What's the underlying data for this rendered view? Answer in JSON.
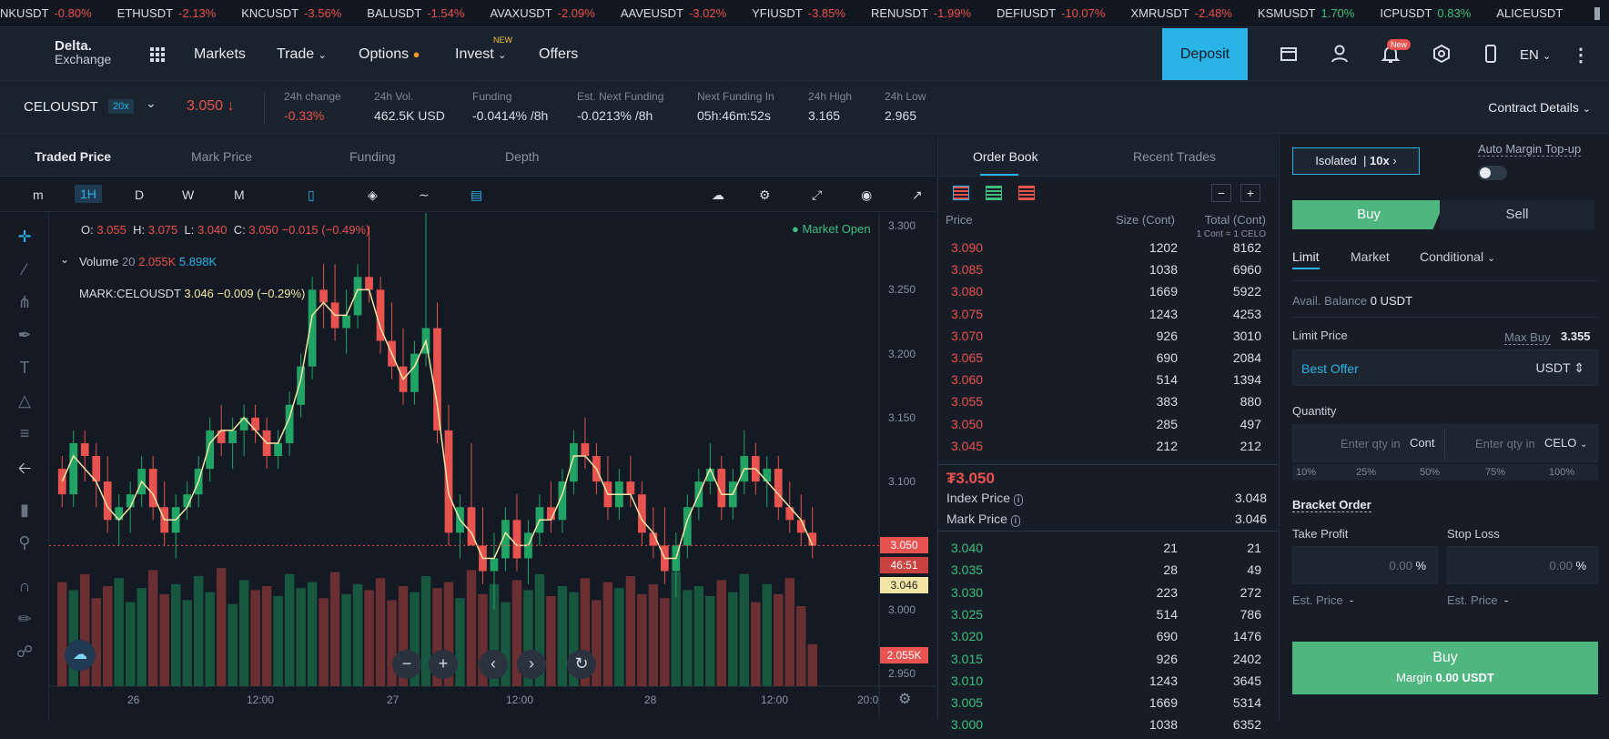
{
  "ticker": [
    {
      "s": "NKUSDT",
      "c": "-0.80%",
      "up": false
    },
    {
      "s": "ETHUSDT",
      "c": "-2.13%",
      "up": false
    },
    {
      "s": "KNCUSDT",
      "c": "-3.56%",
      "up": false
    },
    {
      "s": "BALUSDT",
      "c": "-1.54%",
      "up": false
    },
    {
      "s": "AVAXUSDT",
      "c": "-2.09%",
      "up": false
    },
    {
      "s": "AAVEUSDT",
      "c": "-3.02%",
      "up": false
    },
    {
      "s": "YFIUSDT",
      "c": "-3.85%",
      "up": false
    },
    {
      "s": "RENUSDT",
      "c": "-1.99%",
      "up": false
    },
    {
      "s": "DEFIUSDT",
      "c": "-10.07%",
      "up": false
    },
    {
      "s": "XMRUSDT",
      "c": "-2.48%",
      "up": false
    },
    {
      "s": "KSMUSDT",
      "c": "1.70%",
      "up": true
    },
    {
      "s": "ICPUSDT",
      "c": "0.83%",
      "up": true
    },
    {
      "s": "ALICEUSDT",
      "c": "",
      "up": false
    }
  ],
  "brand": {
    "line1": "Delta.",
    "line2": "Exchange"
  },
  "nav": {
    "markets": "Markets",
    "trade": "Trade",
    "options": "Options",
    "invest": "Invest",
    "invest_tag": "NEW",
    "offers": "Offers",
    "deposit": "Deposit",
    "new_badge": "New",
    "lang": "EN"
  },
  "stats": {
    "symbol": "CELOUSDT",
    "leverage": "20x",
    "last": "3.050",
    "items": [
      {
        "l": "24h change",
        "v": "-0.33%",
        "neg": true
      },
      {
        "l": "24h Vol.",
        "v": "462.5K USD"
      },
      {
        "l": "Funding",
        "v": "-0.0414% /8h"
      },
      {
        "l": "Est. Next Funding",
        "v": "-0.0213% /8h"
      },
      {
        "l": "Next Funding In",
        "v": "05h:46m:52s"
      },
      {
        "l": "24h High",
        "v": "3.165"
      },
      {
        "l": "24h Low",
        "v": "2.965"
      }
    ],
    "contract": "Contract Details"
  },
  "chart_tabs": [
    "Traded Price",
    "Mark Price",
    "Funding",
    "Depth"
  ],
  "toolbar": {
    "m": "m",
    "h": "1H",
    "d": "D",
    "w": "W",
    "mo": "M"
  },
  "legend": {
    "o": "3.055",
    "h": "3.075",
    "l": "3.040",
    "c": "3.050",
    "chg": "−0.015 (−0.49%)",
    "vol_label": "Volume",
    "vol_len": "20",
    "vol1": "2.055K",
    "vol2": "5.898K",
    "mark_label": "MARK:CELOUSDT",
    "mark_val": "3.046",
    "mark_chg": "−0.009 (−0.29%)",
    "market_open": "● Market Open"
  },
  "chart_data": {
    "type": "candlestick",
    "x_labels": [
      "26",
      "12:00",
      "27",
      "12:00",
      "28",
      "12:00",
      "20:0"
    ],
    "y_ticks": [
      "3.300",
      "3.250",
      "3.200",
      "3.150",
      "3.100",
      "3.050",
      "3.000",
      "2.950"
    ],
    "ylim": [
      2.94,
      3.31
    ],
    "last_price": "3.050",
    "countdown": "46:51",
    "mark_price": "3.046",
    "volume_label": "2.055K",
    "candles": [
      [
        3.11,
        3.12,
        3.08,
        3.09
      ],
      [
        3.09,
        3.14,
        3.08,
        3.13
      ],
      [
        3.13,
        3.14,
        3.1,
        3.12
      ],
      [
        3.12,
        3.13,
        3.08,
        3.1
      ],
      [
        3.1,
        3.12,
        3.06,
        3.07
      ],
      [
        3.07,
        3.09,
        3.05,
        3.08
      ],
      [
        3.08,
        3.1,
        3.06,
        3.09
      ],
      [
        3.09,
        3.12,
        3.08,
        3.11
      ],
      [
        3.11,
        3.12,
        3.07,
        3.08
      ],
      [
        3.08,
        3.1,
        3.05,
        3.06
      ],
      [
        3.06,
        3.09,
        3.04,
        3.08
      ],
      [
        3.08,
        3.1,
        3.07,
        3.09
      ],
      [
        3.09,
        3.12,
        3.08,
        3.11
      ],
      [
        3.11,
        3.15,
        3.1,
        3.14
      ],
      [
        3.14,
        3.16,
        3.12,
        3.13
      ],
      [
        3.13,
        3.15,
        3.11,
        3.14
      ],
      [
        3.14,
        3.16,
        3.12,
        3.15
      ],
      [
        3.15,
        3.16,
        3.13,
        3.14
      ],
      [
        3.14,
        3.15,
        3.11,
        3.12
      ],
      [
        3.12,
        3.14,
        3.11,
        3.13
      ],
      [
        3.13,
        3.17,
        3.12,
        3.16
      ],
      [
        3.16,
        3.2,
        3.15,
        3.19
      ],
      [
        3.19,
        3.26,
        3.18,
        3.25
      ],
      [
        3.25,
        3.27,
        3.22,
        3.24
      ],
      [
        3.24,
        3.27,
        3.21,
        3.22
      ],
      [
        3.22,
        3.25,
        3.2,
        3.23
      ],
      [
        3.23,
        3.27,
        3.22,
        3.26
      ],
      [
        3.26,
        3.3,
        3.24,
        3.25
      ],
      [
        3.25,
        3.26,
        3.2,
        3.21
      ],
      [
        3.21,
        3.24,
        3.18,
        3.19
      ],
      [
        3.19,
        3.22,
        3.16,
        3.17
      ],
      [
        3.17,
        3.21,
        3.16,
        3.2
      ],
      [
        3.2,
        3.31,
        3.19,
        3.22
      ],
      [
        3.22,
        3.24,
        3.13,
        3.14
      ],
      [
        3.14,
        3.16,
        3.05,
        3.06
      ],
      [
        3.06,
        3.09,
        3.04,
        3.08
      ],
      [
        3.08,
        3.13,
        3.07,
        3.05
      ],
      [
        3.05,
        3.08,
        3.02,
        3.03
      ],
      [
        3.03,
        3.06,
        3.0,
        3.04
      ],
      [
        3.04,
        3.08,
        3.03,
        3.07
      ],
      [
        3.07,
        3.09,
        3.03,
        3.04
      ],
      [
        3.04,
        3.07,
        3.02,
        3.06
      ],
      [
        3.06,
        3.09,
        3.05,
        3.08
      ],
      [
        3.08,
        3.1,
        3.06,
        3.07
      ],
      [
        3.07,
        3.11,
        3.06,
        3.1
      ],
      [
        3.1,
        3.14,
        3.09,
        3.13
      ],
      [
        3.13,
        3.15,
        3.11,
        3.12
      ],
      [
        3.12,
        3.13,
        3.09,
        3.1
      ],
      [
        3.1,
        3.12,
        3.07,
        3.08
      ],
      [
        3.08,
        3.11,
        3.07,
        3.1
      ],
      [
        3.1,
        3.12,
        3.08,
        3.09
      ],
      [
        3.09,
        3.1,
        3.05,
        3.06
      ],
      [
        3.06,
        3.08,
        3.04,
        3.05
      ],
      [
        3.05,
        3.08,
        3.02,
        3.03
      ],
      [
        3.03,
        3.06,
        3.01,
        3.05
      ],
      [
        3.05,
        3.09,
        3.04,
        3.08
      ],
      [
        3.08,
        3.11,
        3.07,
        3.1
      ],
      [
        3.1,
        3.13,
        3.09,
        3.11
      ],
      [
        3.11,
        3.12,
        3.07,
        3.08
      ],
      [
        3.08,
        3.11,
        3.07,
        3.1
      ],
      [
        3.1,
        3.14,
        3.09,
        3.12
      ],
      [
        3.12,
        3.13,
        3.09,
        3.1
      ],
      [
        3.1,
        3.12,
        3.08,
        3.11
      ],
      [
        3.11,
        3.12,
        3.07,
        3.08
      ],
      [
        3.08,
        3.1,
        3.06,
        3.07
      ],
      [
        3.07,
        3.09,
        3.05,
        3.06
      ],
      [
        3.06,
        3.08,
        3.04,
        3.05
      ]
    ],
    "volumes": [
      5.2,
      4.8,
      5.6,
      4.4,
      5.0,
      5.4,
      4.2,
      4.9,
      5.8,
      4.6,
      5.1,
      4.3,
      5.5,
      4.7,
      5.9,
      4.1,
      5.3,
      4.8,
      5.0,
      4.5,
      5.6,
      4.9,
      5.2,
      4.4,
      5.7,
      4.6,
      5.1,
      4.8,
      5.4,
      4.3,
      5.0,
      4.7,
      5.5,
      4.9,
      5.2,
      4.4,
      5.8,
      4.6,
      5.1,
      4.2,
      5.3,
      4.8,
      5.6,
      4.5,
      5.0,
      4.7,
      5.4,
      4.3,
      5.2,
      4.9,
      5.5,
      4.6,
      5.1,
      4.4,
      5.7,
      4.8,
      5.0,
      4.5,
      5.3,
      4.7,
      5.6,
      4.2,
      5.1,
      4.6,
      5.4,
      4.0,
      2.1
    ],
    "mark_line": [
      3.1,
      3.12,
      3.11,
      3.1,
      3.08,
      3.07,
      3.08,
      3.1,
      3.09,
      3.07,
      3.07,
      3.08,
      3.1,
      3.13,
      3.14,
      3.14,
      3.15,
      3.14,
      3.13,
      3.13,
      3.15,
      3.18,
      3.23,
      3.24,
      3.23,
      3.23,
      3.25,
      3.25,
      3.22,
      3.2,
      3.18,
      3.19,
      3.21,
      3.16,
      3.09,
      3.07,
      3.06,
      3.04,
      3.04,
      3.06,
      3.05,
      3.05,
      3.07,
      3.07,
      3.09,
      3.12,
      3.12,
      3.11,
      3.09,
      3.09,
      3.09,
      3.07,
      3.06,
      3.04,
      3.04,
      3.07,
      3.09,
      3.11,
      3.09,
      3.09,
      3.11,
      3.11,
      3.1,
      3.09,
      3.08,
      3.07,
      3.05
    ]
  },
  "orderbook": {
    "tabs": [
      "Order Book",
      "Recent Trades"
    ],
    "h_price": "Price",
    "h_size": "Size (Cont)",
    "h_total": "Total (Cont)",
    "contract_note": "1 Cont = 1 CELO",
    "asks": [
      [
        "3.090",
        "1202",
        "8162"
      ],
      [
        "3.085",
        "1038",
        "6960"
      ],
      [
        "3.080",
        "1669",
        "5922"
      ],
      [
        "3.075",
        "1243",
        "4253"
      ],
      [
        "3.070",
        "926",
        "3010"
      ],
      [
        "3.065",
        "690",
        "2084"
      ],
      [
        "3.060",
        "514",
        "1394"
      ],
      [
        "3.055",
        "383",
        "880"
      ],
      [
        "3.050",
        "285",
        "497"
      ],
      [
        "3.045",
        "212",
        "212"
      ]
    ],
    "mid": "₮3.050",
    "index_label": "Index Price",
    "index_val": "3.048",
    "mark_label": "Mark Price",
    "mark_val": "3.046",
    "bids": [
      [
        "3.040",
        "21",
        "21"
      ],
      [
        "3.035",
        "28",
        "49"
      ],
      [
        "3.030",
        "223",
        "272"
      ],
      [
        "3.025",
        "514",
        "786"
      ],
      [
        "3.020",
        "690",
        "1476"
      ],
      [
        "3.015",
        "926",
        "2402"
      ],
      [
        "3.010",
        "1243",
        "3645"
      ],
      [
        "3.005",
        "1669",
        "5314"
      ],
      [
        "3.000",
        "1038",
        "6352"
      ]
    ]
  },
  "order": {
    "isolated": "Isolated",
    "lev": "10x",
    "auto_margin": "Auto Margin Top-up",
    "buy": "Buy",
    "sell": "Sell",
    "types": [
      "Limit",
      "Market",
      "Conditional"
    ],
    "avail_label": "Avail. Balance",
    "avail_val": "0 USDT",
    "limit_price": "Limit Price",
    "max_buy": "Max Buy",
    "max_buy_val": "3.355",
    "best_offer": "Best Offer",
    "currency": "USDT",
    "quantity": "Quantity",
    "qty_ph1": "Enter qty in",
    "qty_unit1": "Cont",
    "qty_ph2": "Enter qty in",
    "qty_unit2": "CELO",
    "pcts": [
      "10%",
      "25%",
      "50%",
      "75%",
      "100%"
    ],
    "bracket": "Bracket Order",
    "tp": "Take Profit",
    "sl": "Stop Loss",
    "tp_val": "0.00",
    "sl_val": "0.00",
    "pct": "%",
    "est": "Est. Price",
    "est_val": "-",
    "buy_btn": "Buy",
    "margin": "Margin",
    "margin_val": "0.00 USDT"
  },
  "colors": {
    "up": "#21a366",
    "down": "#e8524f",
    "accent": "#2ab3e6",
    "buy": "#4fb67f"
  }
}
